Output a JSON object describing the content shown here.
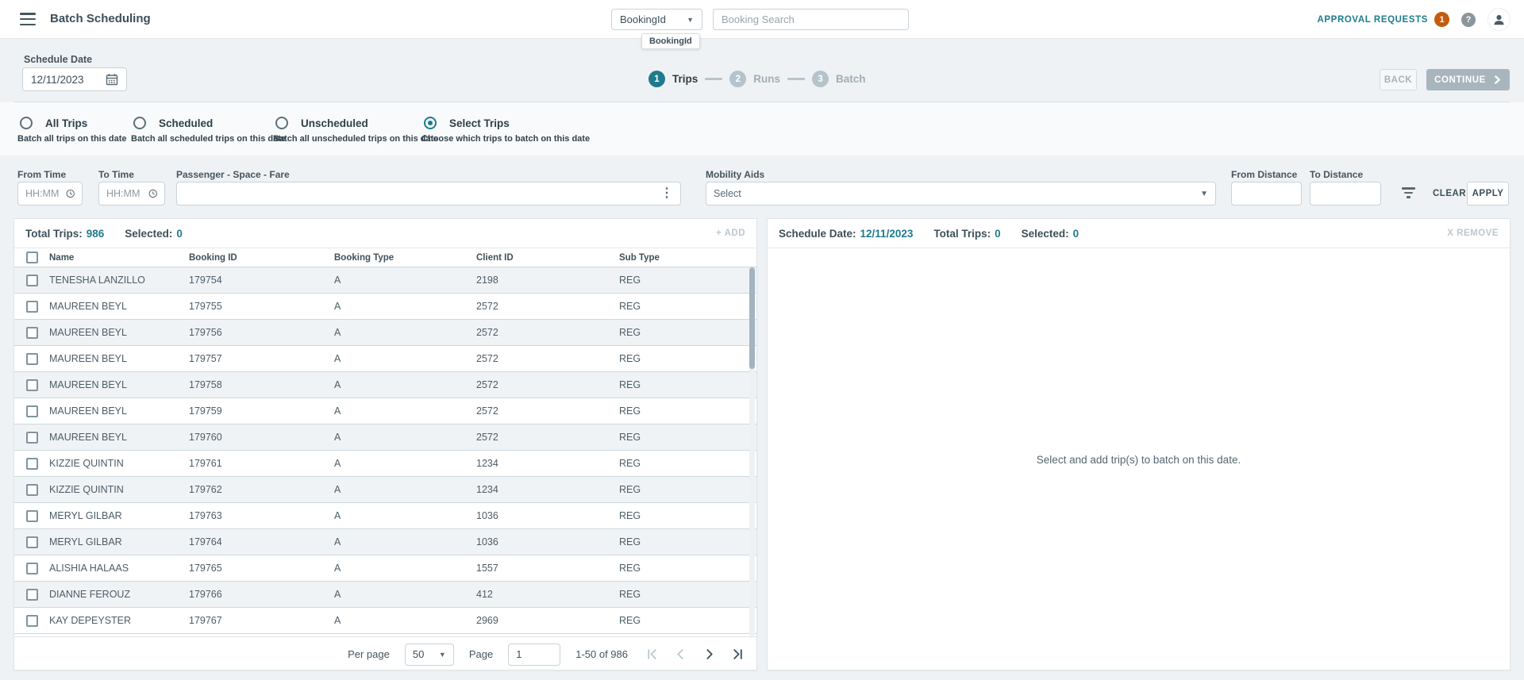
{
  "colors": {
    "accent_teal": "#1e7b8c",
    "badge_orange": "#c45a0e",
    "continue_button_bg": "#a9b5bc",
    "page_background": "#eff2f4",
    "row_alt_background": "#f0f3f5"
  },
  "topbar": {
    "title": "Batch Scheduling",
    "search_type_value": "BookingId",
    "search_type_tooltip": "BookingId",
    "search_placeholder": "Booking Search",
    "approval_label": "APPROVAL REQUESTS",
    "approval_count": "1",
    "help_glyph": "?"
  },
  "toolbar": {
    "schedule_date_label": "Schedule Date",
    "schedule_date_value": "12/11/2023",
    "back_label": "BACK",
    "continue_label": "CONTINUE"
  },
  "stepper": {
    "steps": [
      {
        "num": "1",
        "label": "Trips"
      },
      {
        "num": "2",
        "label": "Runs"
      },
      {
        "num": "3",
        "label": "Batch"
      }
    ]
  },
  "trip_modes": [
    {
      "label": "All Trips",
      "desc": "Batch all trips on this date",
      "selected": false
    },
    {
      "label": "Scheduled",
      "desc": "Batch all scheduled trips on this date",
      "selected": false
    },
    {
      "label": "Unscheduled",
      "desc": "Batch all unscheduled trips on this date",
      "selected": false
    },
    {
      "label": "Select Trips",
      "desc": "Choose which trips to batch on this date",
      "selected": true
    }
  ],
  "filters": {
    "from_time_label": "From Time",
    "from_time_placeholder": "HH:MM",
    "to_time_label": "To Time",
    "to_time_placeholder": "HH:MM",
    "passenger_label": "Passenger - Space - Fare",
    "mobility_label": "Mobility Aids",
    "mobility_value": "Select",
    "from_distance_label": "From Distance",
    "to_distance_label": "To Distance",
    "clear_label": "CLEAR",
    "apply_label": "APPLY"
  },
  "trips_panel": {
    "total_trips_label": "Total Trips:",
    "total_trips": "986",
    "selected_label": "Selected:",
    "selected": "0",
    "add_label": "+ ADD",
    "columns": [
      "Name",
      "Booking ID",
      "Booking Type",
      "Client ID",
      "Sub Type"
    ],
    "rows": [
      {
        "name": "TENESHA LANZILLO",
        "booking_id": "179754",
        "booking_type": "A",
        "client_id": "2198",
        "sub_type": "REG"
      },
      {
        "name": "MAUREEN BEYL",
        "booking_id": "179755",
        "booking_type": "A",
        "client_id": "2572",
        "sub_type": "REG"
      },
      {
        "name": "MAUREEN BEYL",
        "booking_id": "179756",
        "booking_type": "A",
        "client_id": "2572",
        "sub_type": "REG"
      },
      {
        "name": "MAUREEN BEYL",
        "booking_id": "179757",
        "booking_type": "A",
        "client_id": "2572",
        "sub_type": "REG"
      },
      {
        "name": "MAUREEN BEYL",
        "booking_id": "179758",
        "booking_type": "A",
        "client_id": "2572",
        "sub_type": "REG"
      },
      {
        "name": "MAUREEN BEYL",
        "booking_id": "179759",
        "booking_type": "A",
        "client_id": "2572",
        "sub_type": "REG"
      },
      {
        "name": "MAUREEN BEYL",
        "booking_id": "179760",
        "booking_type": "A",
        "client_id": "2572",
        "sub_type": "REG"
      },
      {
        "name": "KIZZIE QUINTIN",
        "booking_id": "179761",
        "booking_type": "A",
        "client_id": "1234",
        "sub_type": "REG"
      },
      {
        "name": "KIZZIE QUINTIN",
        "booking_id": "179762",
        "booking_type": "A",
        "client_id": "1234",
        "sub_type": "REG"
      },
      {
        "name": "MERYL GILBAR",
        "booking_id": "179763",
        "booking_type": "A",
        "client_id": "1036",
        "sub_type": "REG"
      },
      {
        "name": "MERYL GILBAR",
        "booking_id": "179764",
        "booking_type": "A",
        "client_id": "1036",
        "sub_type": "REG"
      },
      {
        "name": "ALISHIA HALAAS",
        "booking_id": "179765",
        "booking_type": "A",
        "client_id": "1557",
        "sub_type": "REG"
      },
      {
        "name": "DIANNE FEROUZ",
        "booking_id": "179766",
        "booking_type": "A",
        "client_id": "412",
        "sub_type": "REG"
      },
      {
        "name": "KAY DEPEYSTER",
        "booking_id": "179767",
        "booking_type": "A",
        "client_id": "2969",
        "sub_type": "REG"
      }
    ],
    "pagination": {
      "per_page_label": "Per page",
      "per_page_value": "50",
      "page_label": "Page",
      "page_value": "1",
      "range_text": "1-50 of 986"
    }
  },
  "batch_panel": {
    "schedule_date_label": "Schedule Date:",
    "schedule_date": "12/11/2023",
    "total_trips_label": "Total Trips:",
    "total_trips": "0",
    "selected_label": "Selected:",
    "selected": "0",
    "remove_label": "X REMOVE",
    "empty_text": "Select and add trip(s) to batch on this date."
  }
}
